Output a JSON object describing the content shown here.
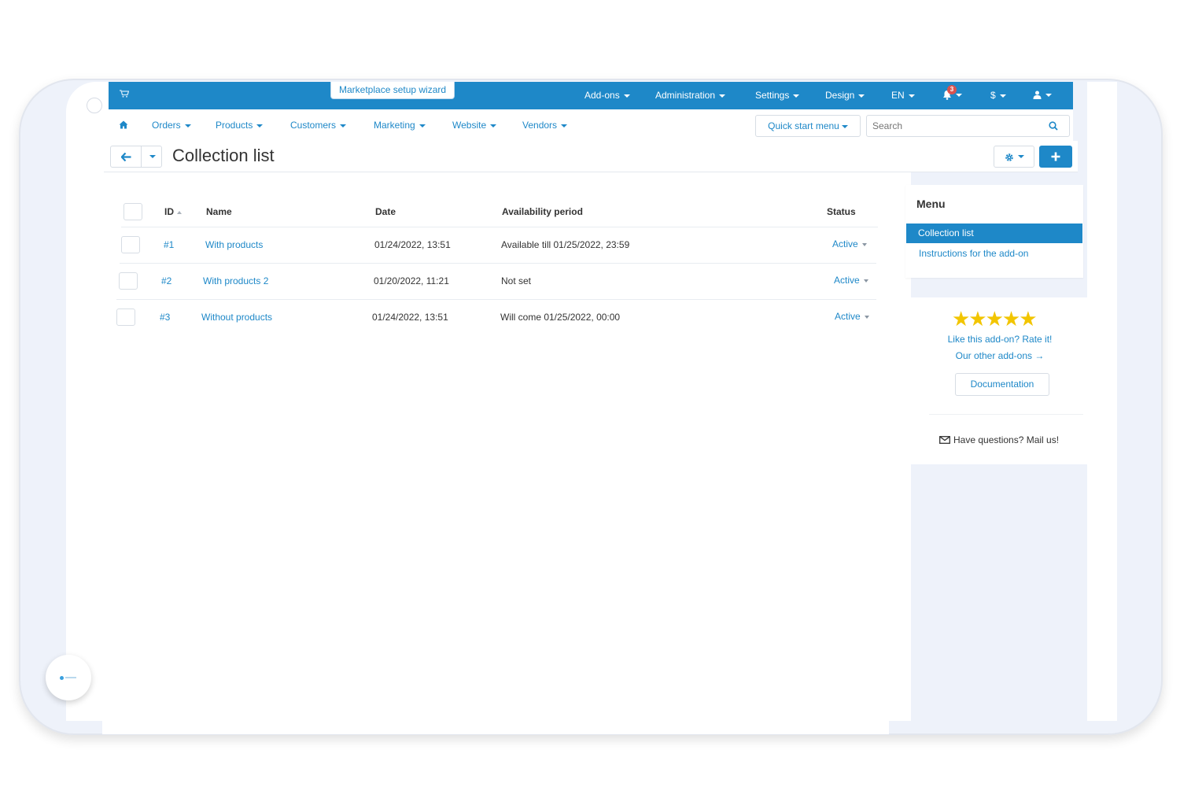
{
  "topbar": {
    "wizard_label": "Marketplace setup wizard",
    "items": [
      {
        "label": "Add-ons"
      },
      {
        "label": "Administration"
      },
      {
        "label": "Settings"
      },
      {
        "label": "Design"
      },
      {
        "label": "EN"
      }
    ],
    "notifications_count": "3",
    "currency_label": "$",
    "accent_color": "#1e88c8"
  },
  "nav": {
    "items": [
      {
        "label": "Orders"
      },
      {
        "label": "Products"
      },
      {
        "label": "Customers"
      },
      {
        "label": "Marketing"
      },
      {
        "label": "Website"
      },
      {
        "label": "Vendors"
      }
    ],
    "quick_start_label": "Quick start menu",
    "search_placeholder": "Search"
  },
  "page": {
    "title": "Collection list"
  },
  "table": {
    "headers": {
      "id": "ID",
      "name": "Name",
      "date": "Date",
      "availability": "Availability period",
      "status": "Status"
    },
    "rows": [
      {
        "id": "#1",
        "name": "With products",
        "date": "01/24/2022, 13:51",
        "availability": "Available till 01/25/2022, 23:59",
        "status": "Active"
      },
      {
        "id": "#2",
        "name": "With products 2",
        "date": "01/20/2022, 11:21",
        "availability": "Not set",
        "status": "Active"
      },
      {
        "id": "#3",
        "name": "Without products",
        "date": "01/24/2022, 13:51",
        "availability": "Will come 01/25/2022, 00:00",
        "status": "Active"
      }
    ]
  },
  "menu": {
    "title": "Menu",
    "items": [
      {
        "label": "Collection list"
      },
      {
        "label": "Instructions for the add-on"
      }
    ]
  },
  "rating": {
    "stars": "★★★★★",
    "rate_text": "Like this add-on? Rate it!",
    "other_addons": "Our other add-ons →",
    "documentation_label": "Documentation",
    "mail_text": "Have questions? Mail us!"
  }
}
